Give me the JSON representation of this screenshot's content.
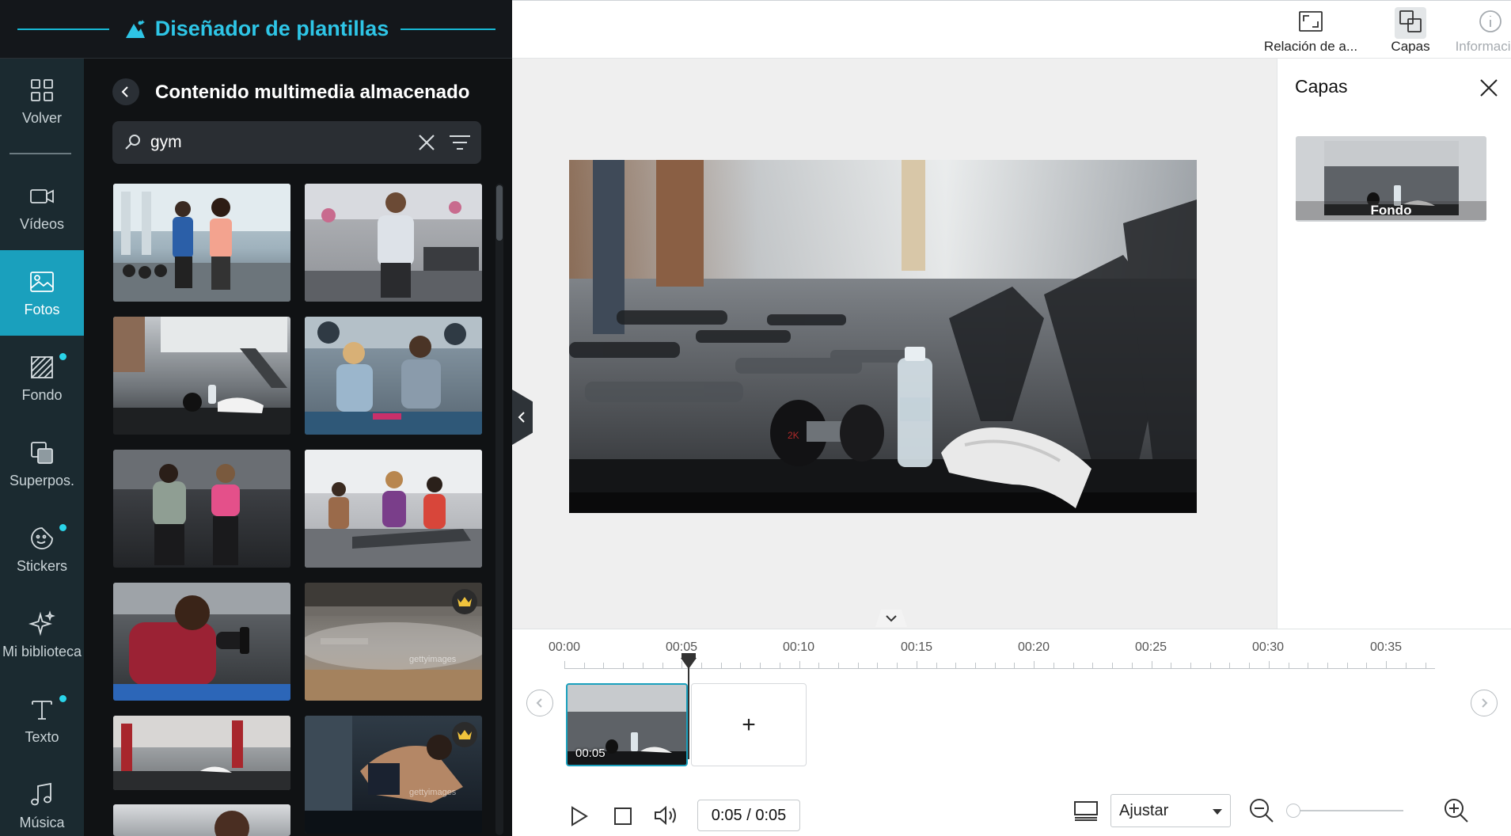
{
  "app": {
    "title": "Diseñador de plantillas"
  },
  "sidebar": {
    "items": [
      {
        "label": "Volver",
        "icon": "grid-icon"
      },
      {
        "label": "Vídeos",
        "icon": "video-camera-icon"
      },
      {
        "label": "Fotos",
        "icon": "image-icon",
        "active": true
      },
      {
        "label": "Fondo",
        "icon": "background-pattern-icon",
        "dot": true
      },
      {
        "label": "Superpos.",
        "icon": "overlay-icon"
      },
      {
        "label": "Stickers",
        "icon": "sticker-icon",
        "dot": true
      },
      {
        "label": "Mi biblioteca",
        "icon": "sparkle-icon"
      },
      {
        "label": "Texto",
        "icon": "text-icon",
        "dot": true
      },
      {
        "label": "Música",
        "icon": "music-note-icon"
      }
    ]
  },
  "media": {
    "title": "Contenido multimedia almacenado",
    "search": {
      "value": "gym",
      "placeholder": ""
    },
    "premium_indicator": "crown-icon",
    "watermark_text": "gettyimages"
  },
  "toolbar": {
    "aspect_label": "Relación de a...",
    "layers_label": "Capas",
    "info_label": "Información"
  },
  "layers": {
    "title": "Capas",
    "items": [
      {
        "label": "Fondo"
      }
    ]
  },
  "timeline": {
    "ruler": [
      "00:00",
      "00:05",
      "00:10",
      "00:15",
      "00:20",
      "00:25",
      "00:30",
      "00:35"
    ],
    "clip_duration": "00:05",
    "add_label": "+",
    "time_display": "0:05 / 0:05",
    "fit_option": "Ajustar",
    "zoom_level": 0
  },
  "colors": {
    "accent": "#1aa0bd",
    "title_blue": "#2ec5e6",
    "sidebar_bg": "#1b2a30",
    "panel_bg": "#101214"
  }
}
